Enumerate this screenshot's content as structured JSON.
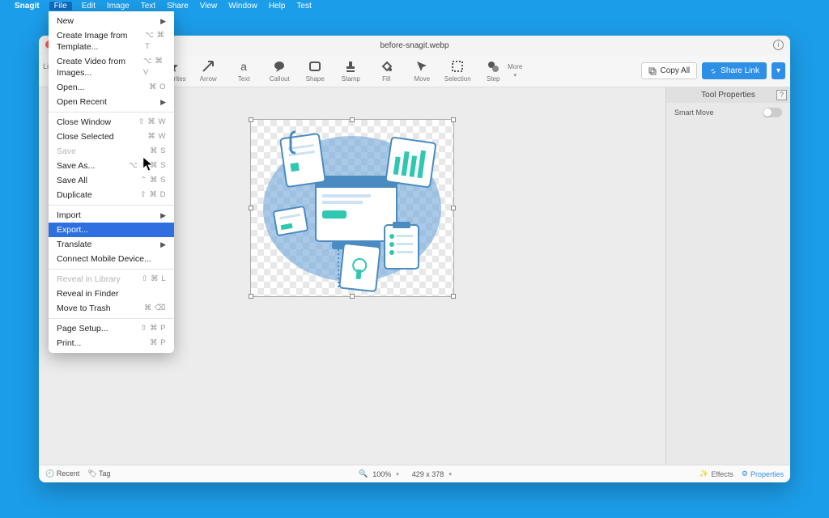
{
  "menubar": {
    "app": "Snagit",
    "items": [
      "File",
      "Edit",
      "Image",
      "Text",
      "Share",
      "View",
      "Window",
      "Help",
      "Test"
    ],
    "active_index": 0
  },
  "window": {
    "title": "before-snagit.webp"
  },
  "side_library": "Lib",
  "toolbar": {
    "tools": [
      {
        "name": "favorites",
        "label": "Favorites"
      },
      {
        "name": "arrow",
        "label": "Arrow"
      },
      {
        "name": "text",
        "label": "Text"
      },
      {
        "name": "callout",
        "label": "Callout"
      },
      {
        "name": "shape",
        "label": "Shape"
      },
      {
        "name": "stamp",
        "label": "Stamp"
      },
      {
        "name": "fill",
        "label": "Fill"
      },
      {
        "name": "move",
        "label": "Move"
      },
      {
        "name": "selection",
        "label": "Selection"
      },
      {
        "name": "step",
        "label": "Step"
      }
    ],
    "more": "More",
    "copy_all": "Copy All",
    "share_link": "Share Link"
  },
  "props": {
    "header": "Tool Properties",
    "smart_move": "Smart Move"
  },
  "status": {
    "recent": "Recent",
    "tag": "Tag",
    "zoom": "100%",
    "dims": "429 x 378",
    "effects": "Effects",
    "properties": "Properties"
  },
  "file_menu": [
    {
      "label": "New",
      "shortcut": "",
      "sub": true
    },
    {
      "label": "Create Image from Template...",
      "shortcut": "⌥ ⌘ T"
    },
    {
      "label": "Create Video from Images...",
      "shortcut": "⌥ ⌘ V"
    },
    {
      "label": "Open...",
      "shortcut": "⌘ O"
    },
    {
      "label": "Open Recent",
      "shortcut": "",
      "sub": true
    },
    {
      "sep": true
    },
    {
      "label": "Close Window",
      "shortcut": "⇧ ⌘ W"
    },
    {
      "label": "Close Selected",
      "shortcut": "⌘ W"
    },
    {
      "label": "Save",
      "shortcut": "⌘ S",
      "disabled": true
    },
    {
      "label": "Save As...",
      "shortcut": "⌥ ⇧ ⌘ S"
    },
    {
      "label": "Save All",
      "shortcut": "⌃ ⌘ S"
    },
    {
      "label": "Duplicate",
      "shortcut": "⇧ ⌘ D"
    },
    {
      "sep": true
    },
    {
      "label": "Import",
      "shortcut": "",
      "sub": true
    },
    {
      "label": "Export...",
      "shortcut": "",
      "hl": true
    },
    {
      "label": "Translate",
      "shortcut": "",
      "sub": true
    },
    {
      "label": "Connect Mobile Device...",
      "shortcut": ""
    },
    {
      "sep": true
    },
    {
      "label": "Reveal in Library",
      "shortcut": "⇧ ⌘ L",
      "disabled": true
    },
    {
      "label": "Reveal in Finder",
      "shortcut": ""
    },
    {
      "label": "Move to Trash",
      "shortcut": "⌘ ⌫"
    },
    {
      "sep": true
    },
    {
      "label": "Page Setup...",
      "shortcut": "⇧ ⌘ P"
    },
    {
      "label": "Print...",
      "shortcut": "⌘ P"
    }
  ]
}
